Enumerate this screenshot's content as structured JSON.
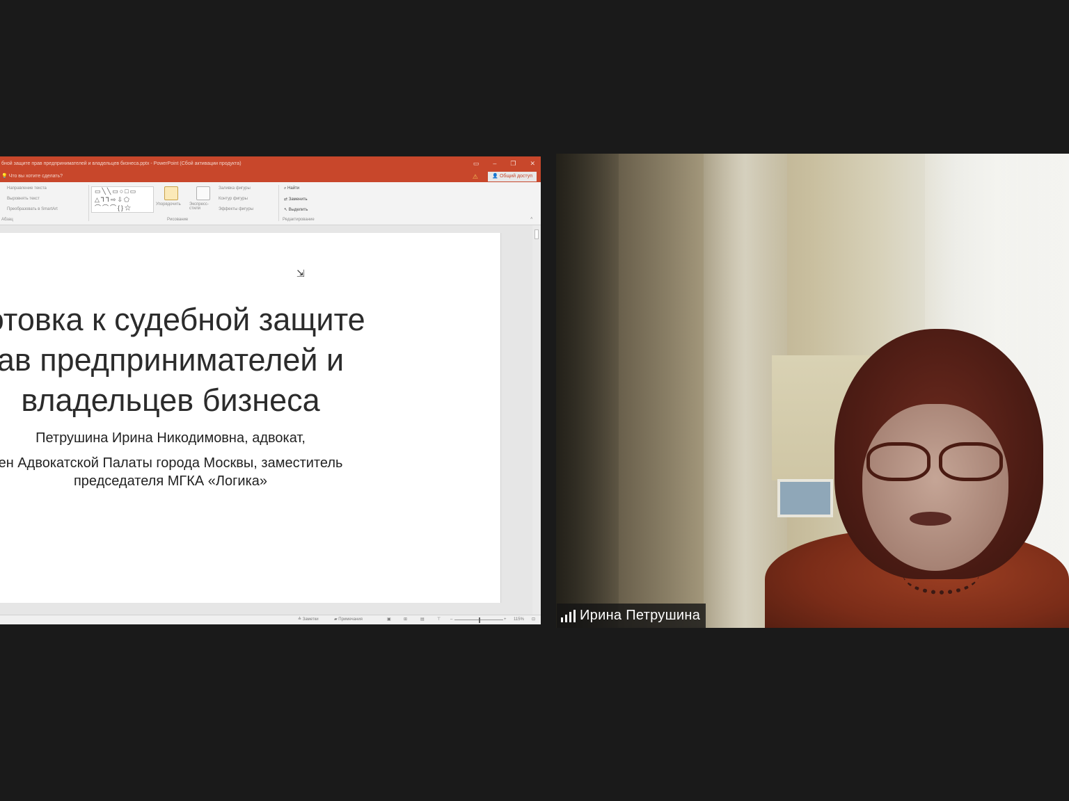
{
  "ppt": {
    "title": "бной защите прав предпринимателей и владельцев бизнеса.pptx - PowerPoint (Сбой активации продукта)",
    "tell_me": "Что вы хотите сделать?",
    "share_label": "Общий доступ",
    "ribbon": {
      "text_direction": "Направление текста",
      "align_text": "Выровнять текст",
      "convert_smartart": "Преобразовать в SmartArt",
      "arrange": "Упорядочить",
      "quick_styles": "Экспресс-стили",
      "shape_fill": "Заливка фигуры",
      "shape_outline": "Контур фигуры",
      "shape_effects": "Эффекты фигуры",
      "find": "Найти",
      "replace": "Заменить",
      "select": "Выделить",
      "group_paragraph": "Абзац",
      "group_drawing": "Рисование",
      "group_editing": "Редактирование"
    },
    "slide": {
      "title_lines": [
        "готовка к судебной защите",
        "ав предпринимателей и",
        "владельцев бизнеса"
      ],
      "subtitle1": "Петрушина Ирина Никодимовна, адвокат,",
      "subtitle2_line1": "ен Адвокатской Палаты города Москвы, заместитель",
      "subtitle2_line2": "председателя МГКА «Логика»"
    },
    "status": {
      "notes": "Заметки",
      "comments": "Примечания",
      "zoom": "115%"
    }
  },
  "participant": {
    "name": "Ирина Петрушина"
  },
  "colors": {
    "ppt_accent": "#c8472b",
    "background": "#1a1a1a"
  }
}
